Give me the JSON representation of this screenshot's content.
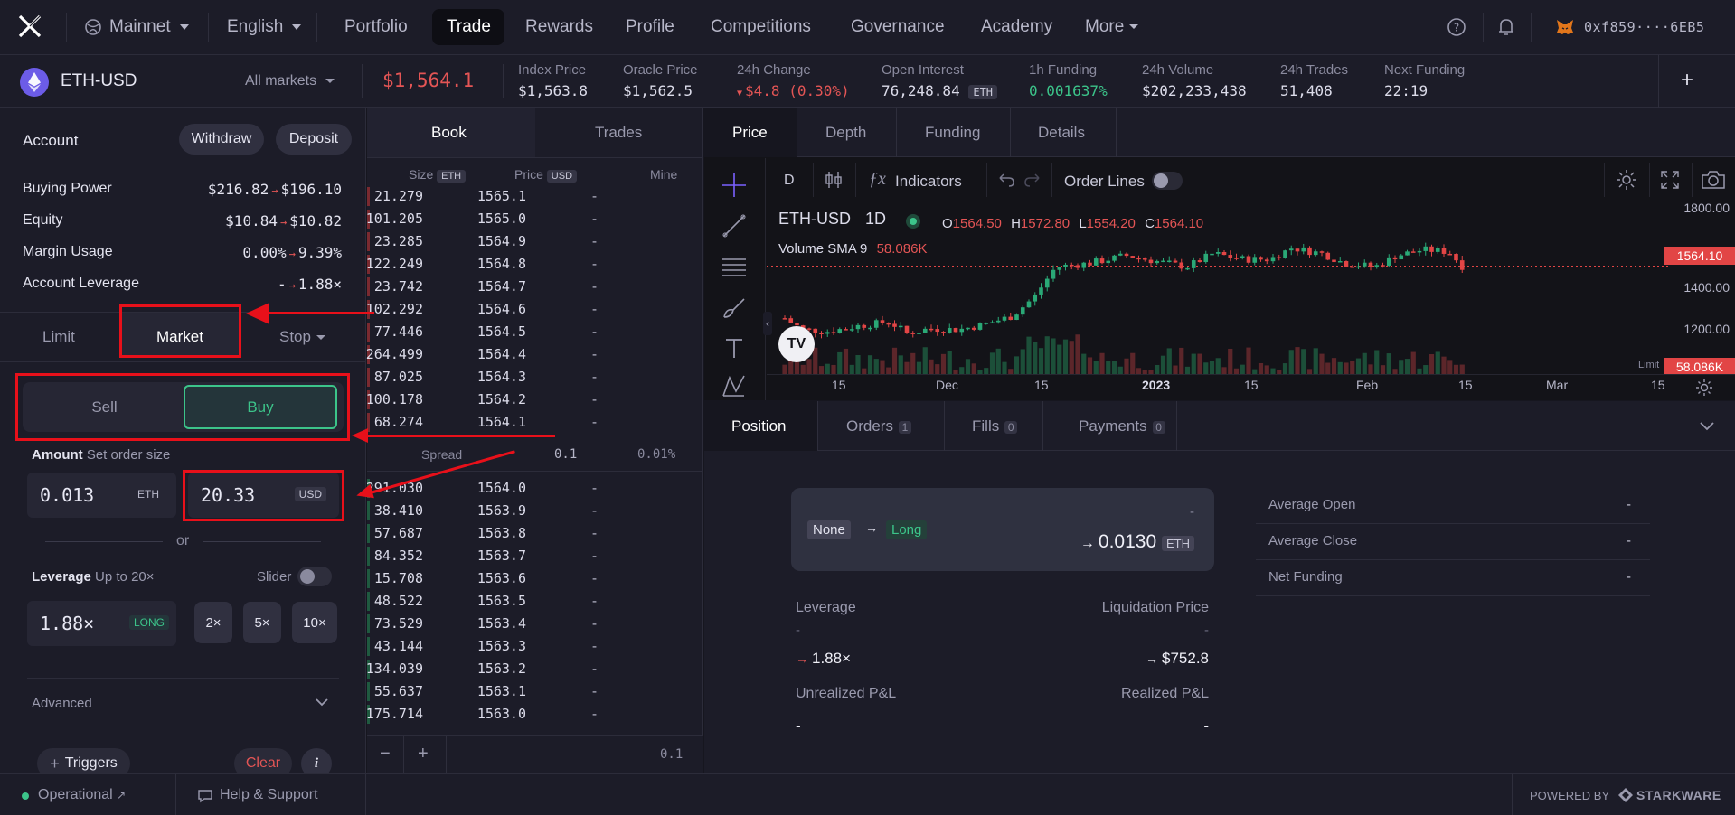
{
  "nav": {
    "network": "Mainnet",
    "language": "English",
    "links": [
      "Portfolio",
      "Trade",
      "Rewards",
      "Profile",
      "Competitions",
      "Governance",
      "Academy"
    ],
    "more": "More",
    "wallet": "0xf859····6EB5"
  },
  "market": {
    "symbol": "ETH-USD",
    "all_markets": "All markets",
    "price": "$1,564.1",
    "stats": [
      {
        "label": "Index Price",
        "value": "$1,563.8"
      },
      {
        "label": "Oracle Price",
        "value": "$1,562.5"
      },
      {
        "label": "24h Change",
        "value": "$4.8 (0.30%)"
      },
      {
        "label": "Open Interest",
        "value": "76,248.84",
        "unit": "ETH"
      },
      {
        "label": "1h Funding",
        "value": "0.001637%"
      },
      {
        "label": "24h Volume",
        "value": "$202,233,438"
      },
      {
        "label": "24h Trades",
        "value": "51,408"
      },
      {
        "label": "Next Funding",
        "value": "22:19"
      }
    ]
  },
  "account": {
    "title": "Account",
    "withdraw": "Withdraw",
    "deposit": "Deposit",
    "rows": [
      {
        "label": "Buying Power",
        "from": "$216.82",
        "to": "$196.10"
      },
      {
        "label": "Equity",
        "from": "$10.84",
        "to": "$10.82"
      },
      {
        "label": "Margin Usage",
        "from": "0.00%",
        "to": "9.39%"
      },
      {
        "label": "Account Leverage",
        "from": "-",
        "to": "1.88×"
      }
    ]
  },
  "order": {
    "tabs": [
      "Limit",
      "Market",
      "Stop"
    ],
    "sell": "Sell",
    "buy": "Buy",
    "amount_label": "Amount",
    "amount_hint": "Set order size",
    "amount_eth": "0.013",
    "eth": "ETH",
    "amount_usd": "20.33",
    "usd": "USD",
    "or": "or",
    "leverage_label": "Leverage",
    "leverage_hint": "Up to 20×",
    "slider": "Slider",
    "leverage_value": "1.88×",
    "long": "LONG",
    "lev_buttons": [
      "2×",
      "5×",
      "10×"
    ],
    "advanced": "Advanced",
    "triggers": "Triggers",
    "clear": "Clear",
    "info": "i"
  },
  "orderbook": {
    "tabs": [
      "Book",
      "Trades"
    ],
    "headers": {
      "size": "Size",
      "size_unit": "ETH",
      "price": "Price",
      "price_unit": "USD",
      "mine": "Mine"
    },
    "asks": [
      [
        "21.279",
        "1565.1"
      ],
      [
        "101.205",
        "1565.0"
      ],
      [
        "23.285",
        "1564.9"
      ],
      [
        "122.249",
        "1564.8"
      ],
      [
        "23.742",
        "1564.7"
      ],
      [
        "102.292",
        "1564.6"
      ],
      [
        "77.446",
        "1564.5"
      ],
      [
        "264.499",
        "1564.4"
      ],
      [
        "87.025",
        "1564.3"
      ],
      [
        "100.178",
        "1564.2"
      ],
      [
        "68.274",
        "1564.1"
      ]
    ],
    "spread_label": "Spread",
    "spread_value": "0.1",
    "spread_pct": "0.01%",
    "bids": [
      [
        "291.030",
        "1564.0"
      ],
      [
        "38.410",
        "1563.9"
      ],
      [
        "57.687",
        "1563.8"
      ],
      [
        "84.352",
        "1563.7"
      ],
      [
        "15.708",
        "1563.6"
      ],
      [
        "48.522",
        "1563.5"
      ],
      [
        "73.529",
        "1563.4"
      ],
      [
        "43.144",
        "1563.3"
      ],
      [
        "134.039",
        "1563.2"
      ],
      [
        "55.637",
        "1563.1"
      ],
      [
        "175.714",
        "1563.0"
      ]
    ],
    "dash": "-",
    "minus": "−",
    "plus": "+",
    "grouping": "0.1"
  },
  "chart": {
    "tabs": [
      "Price",
      "Depth",
      "Funding",
      "Details"
    ],
    "interval_btn": "D",
    "indicators": "Indicators",
    "order_lines": "Order Lines",
    "symbol": "ETH-USD",
    "interval": "1D",
    "ohlc": [
      {
        "k": "O",
        "v": "1564.50"
      },
      {
        "k": "H",
        "v": "1572.80"
      },
      {
        "k": "L",
        "v": "1554.20"
      },
      {
        "k": "C",
        "v": "1564.10"
      }
    ],
    "volume_label": "Volume SMA 9",
    "volume_value": "58.086K",
    "y_ticks": [
      "1800.00",
      "1400.00",
      "1200.00"
    ],
    "last_price": "1564.10",
    "last_volume": "58.086K",
    "limit_label": "Limit",
    "x_ticks": [
      "15",
      "Dec",
      "15",
      "2023",
      "15",
      "Feb",
      "15",
      "Mar",
      "15"
    ]
  },
  "position": {
    "tabs": [
      {
        "label": "Position"
      },
      {
        "label": "Orders",
        "count": "1"
      },
      {
        "label": "Fills",
        "count": "0"
      },
      {
        "label": "Payments",
        "count": "0"
      }
    ],
    "from": "None",
    "to": "Long",
    "dash": "-",
    "size": "0.0130",
    "unit": "ETH",
    "leverage_label": "Leverage",
    "leverage_from": "-",
    "leverage_to": "1.88×",
    "liq_label": "Liquidation Price",
    "liq_from": "-",
    "liq_to": "$752.8",
    "upnl_label": "Unrealized P&L",
    "upnl": "-",
    "rpnl_label": "Realized P&L",
    "rpnl": "-",
    "details": [
      {
        "label": "Average Open",
        "value": "-"
      },
      {
        "label": "Average Close",
        "value": "-"
      },
      {
        "label": "Net Funding",
        "value": "-"
      }
    ]
  },
  "footer": {
    "status": "Operational",
    "help": "Help & Support",
    "powered": "POWERED BY",
    "brand": "STARKWARE"
  },
  "colors": {
    "background": "#16161f",
    "panel": "#1c1c28",
    "ask": "#e45555",
    "bid": "#3cc48a",
    "accent": "#7b61ff",
    "annotation": "#e8101a"
  }
}
